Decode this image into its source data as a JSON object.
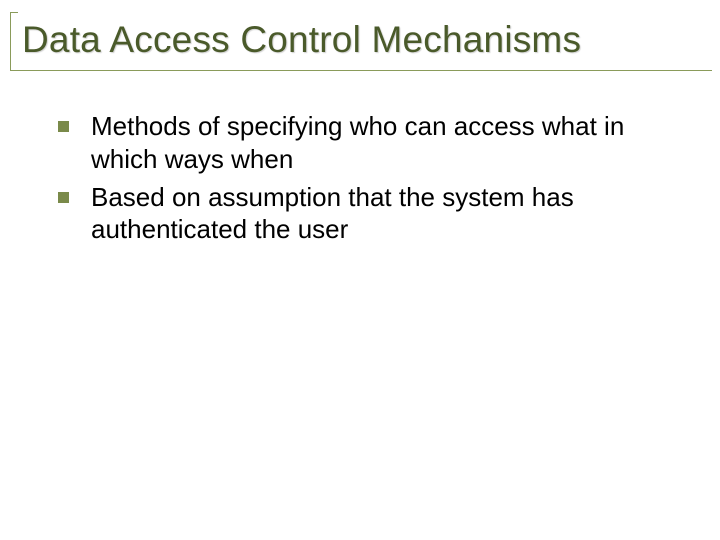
{
  "slide": {
    "title": "Data Access Control Mechanisms",
    "bullets": [
      {
        "text": "Methods of specifying who can access what in which ways when"
      },
      {
        "text": "Based on assumption that the system has authenticated the user"
      }
    ]
  },
  "colors": {
    "title": "#4a5a2a",
    "rule": "#8a9b5a",
    "bullet_square": "#7a8a4a",
    "body_text": "#000000"
  }
}
